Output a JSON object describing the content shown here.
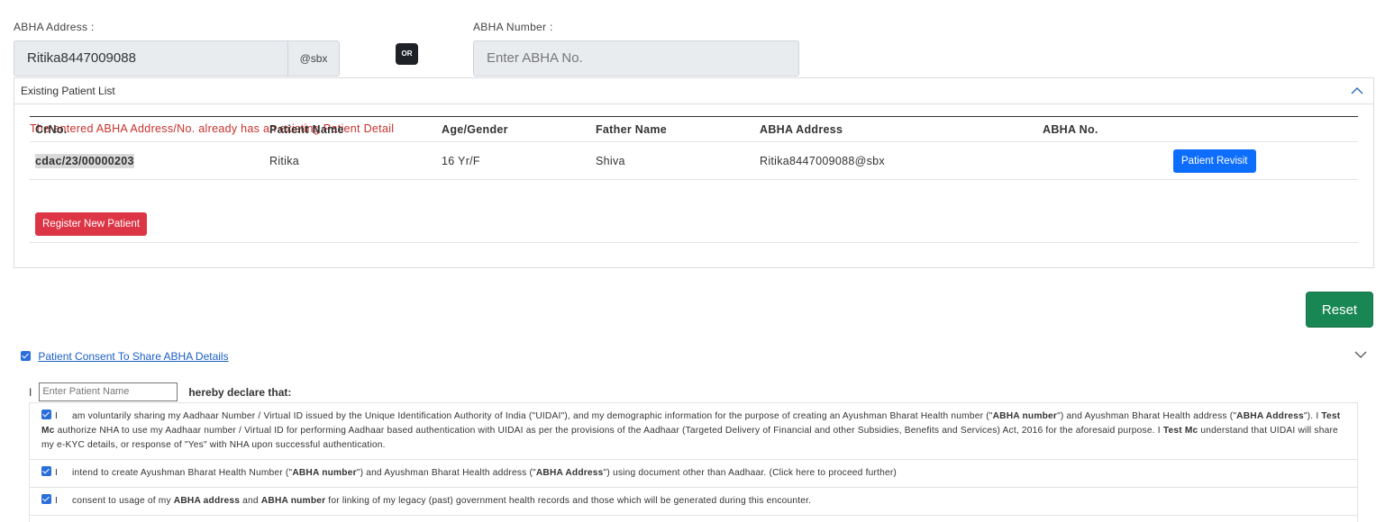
{
  "abha_address": {
    "label": "ABHA Address :",
    "value": "Ritika8447009088",
    "suffix": "@sbx"
  },
  "or_label": "OR",
  "abha_number": {
    "label": "ABHA Number :",
    "placeholder": "Enter ABHA No."
  },
  "existing_list": {
    "title": "Existing Patient List",
    "warning": "The entered ABHA Address/No. already has an existing Patient Detail",
    "columns": [
      "CrNo.",
      "Patient Name",
      "Age/Gender",
      "Father Name",
      "ABHA Address",
      "ABHA No."
    ],
    "rows": [
      {
        "crno": "cdac/23/00000203",
        "patient_name": "Ritika",
        "age_gender": "16 Yr/F",
        "father_name": "Shiva",
        "abha_address": "Ritika8447009088@sbx",
        "abha_no": "",
        "action": "Patient Revisit"
      }
    ],
    "register_button": "Register New Patient"
  },
  "reset_button": "Reset",
  "consent": {
    "link": "Patient Consent To Share ABHA Details",
    "declare_prefix": "I",
    "name_placeholder": "Enter Patient Name",
    "declare_suffix": "hereby declare that:",
    "clauses": {
      "c1": {
        "i": "I",
        "t1": "am voluntarily sharing my Aadhaar Number / Virtual ID issued by the Unique Identification Authority of India (\"UIDAI\"), and my demographic information for the purpose of creating an Ayushman Bharat Health number (\"",
        "b1": "ABHA number",
        "t2": "\") and Ayushman Bharat Health address (\"",
        "b2": "ABHA Address",
        "t3": "\"). I ",
        "b3": "Test Mc",
        "t4": " authorize NHA to use my Aadhaar number / Virtual ID for performing Aadhaar based authentication with UIDAI as per the provisions of the Aadhaar (Targeted Delivery of Financial and other Subsidies, Benefits and Services) Act, 2016 for the aforesaid purpose. I ",
        "b4": "Test Mc",
        "t5": " understand that UIDAI will share my e-KYC details, or response of \"Yes\" with NHA upon successful authentication."
      },
      "c2": {
        "i": "I",
        "t1": "intend to create Ayushman Bharat Health Number (\"",
        "b1": "ABHA number",
        "t2": "\") and Ayushman Bharat Health address (\"",
        "b2": "ABHA Address",
        "t3": "\") using document other than Aadhaar. (Click here to proceed further)"
      },
      "c3": {
        "i": "I",
        "t1": "consent to usage of my ",
        "b1": "ABHA address",
        "t2": " and ",
        "b2": "ABHA number",
        "t3": " for linking of my legacy (past) government health records and those which will be generated during this encounter."
      }
    }
  },
  "colors": {
    "primary": "#0d6efd",
    "danger": "#dc3545",
    "success": "#198754",
    "warning_text": "#c9302c",
    "link": "#1b5fc4"
  }
}
